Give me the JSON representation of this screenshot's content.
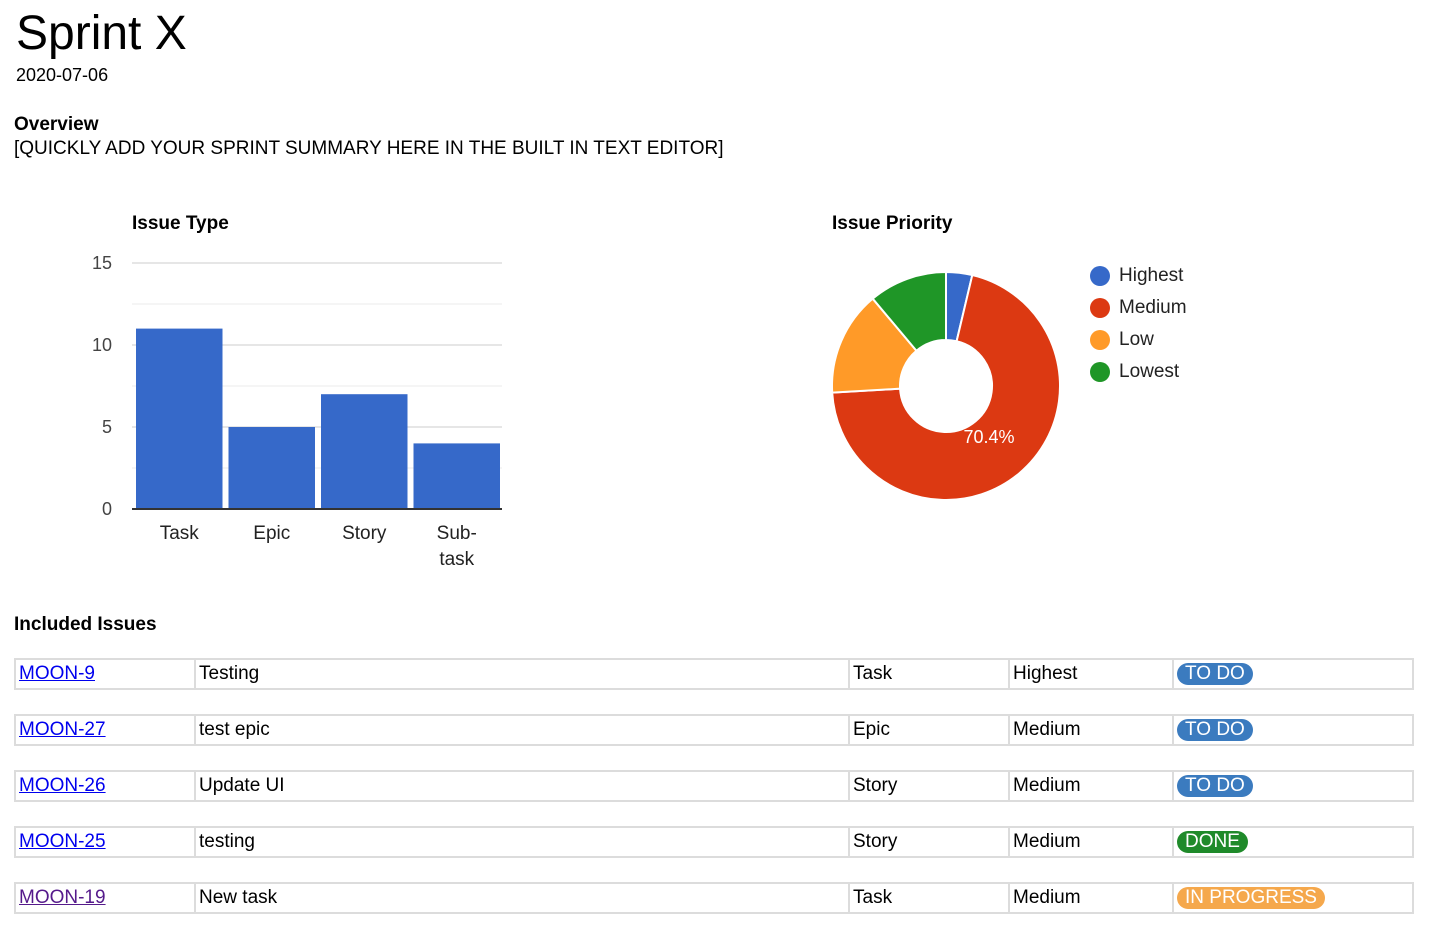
{
  "page": {
    "title": "Sprint X",
    "date": "2020-07-06"
  },
  "overview": {
    "heading": "Overview",
    "text": "[QUICKLY ADD YOUR SPRINT SUMMARY HERE IN THE BUILT IN TEXT EDITOR]"
  },
  "chart_data": [
    {
      "type": "bar",
      "title": "Issue Type",
      "categories": [
        "Task",
        "Epic",
        "Story",
        "Sub-task"
      ],
      "category_labels": [
        [
          "Task"
        ],
        [
          "Epic"
        ],
        [
          "Story"
        ],
        [
          "Sub-",
          "task"
        ]
      ],
      "values": [
        11,
        5,
        7,
        4
      ],
      "xlabel": "",
      "ylabel": "",
      "ylim": [
        0,
        15
      ],
      "yticks": [
        0,
        5,
        10,
        15
      ],
      "minor_gridlines": [
        2.5,
        7.5,
        12.5
      ],
      "grid": true,
      "color": "#3669c9"
    },
    {
      "type": "pie",
      "donut": true,
      "title": "Issue Priority",
      "labels": [
        "Highest",
        "Medium",
        "Low",
        "Lowest"
      ],
      "values": [
        1,
        19,
        4,
        3
      ],
      "colors": [
        "#3669c9",
        "#dc3912",
        "#ff9a28",
        "#1f9627"
      ],
      "slice_labels": [
        "",
        "70.4%",
        "",
        ""
      ],
      "legend": "right"
    }
  ],
  "issues": {
    "heading": "Included Issues",
    "status_colors": {
      "TO DO": "#3b7bbf",
      "DONE": "#1f8a2a",
      "IN PROGRESS": "#f5a84c"
    },
    "rows": [
      {
        "key": "MOON-9",
        "summary": "Testing",
        "type": "Task",
        "priority": "Highest",
        "status": "TO DO",
        "visited": false
      },
      {
        "key": "MOON-27",
        "summary": "test epic",
        "type": "Epic",
        "priority": "Medium",
        "status": "TO DO",
        "visited": false
      },
      {
        "key": "MOON-26",
        "summary": "Update UI",
        "type": "Story",
        "priority": "Medium",
        "status": "TO DO",
        "visited": false
      },
      {
        "key": "MOON-25",
        "summary": "testing",
        "type": "Story",
        "priority": "Medium",
        "status": "DONE",
        "visited": false
      },
      {
        "key": "MOON-19",
        "summary": "New task",
        "type": "Task",
        "priority": "Medium",
        "status": "IN PROGRESS",
        "visited": true
      }
    ]
  }
}
